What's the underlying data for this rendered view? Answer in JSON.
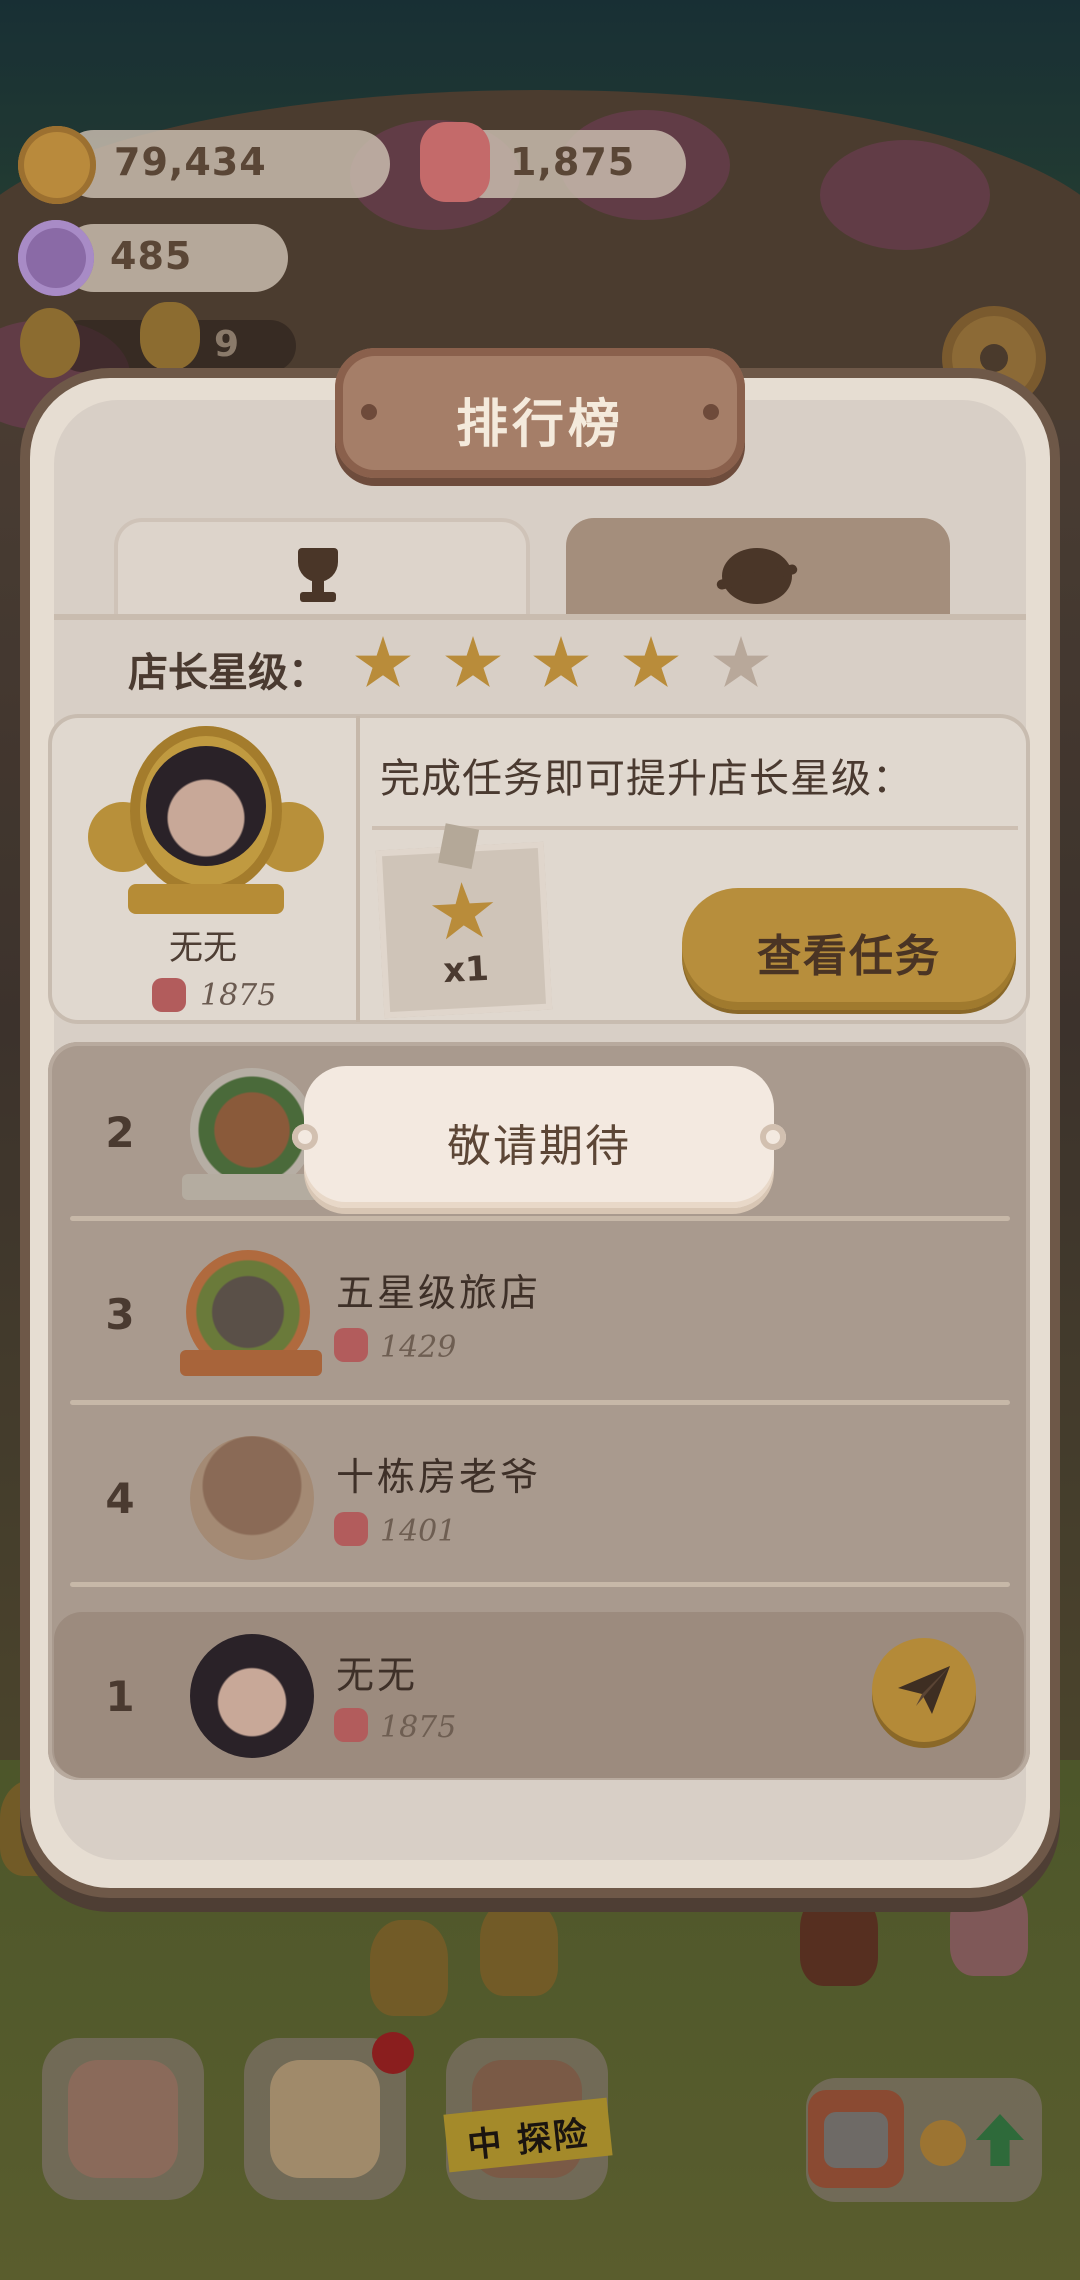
{
  "currencies": {
    "cookies": {
      "value": "79,434",
      "icon": "cookie-icon"
    },
    "gems": {
      "value": "1,875",
      "icon": "gem-icon"
    },
    "candy": {
      "value": "485",
      "icon": "candy-icon"
    }
  },
  "level_counter": {
    "value": "9"
  },
  "panel": {
    "title": "排行榜",
    "tabs": [
      {
        "icon": "trophy-icon",
        "active": true
      },
      {
        "icon": "planet-icon",
        "active": false
      }
    ],
    "star_label": "店长星级：",
    "stars_filled": 4,
    "stars_total": 5,
    "profile": {
      "name": "无无",
      "score": "1875"
    },
    "task_prompt": "完成任务即可提升店长星级：",
    "task_reward": "x1",
    "view_task_button": "查看任务"
  },
  "coming_soon": "敬请期待",
  "ranking": [
    {
      "rank": "2",
      "name": "",
      "score": ""
    },
    {
      "rank": "3",
      "name": "五星级旅店",
      "score": "1429"
    },
    {
      "rank": "4",
      "name": "十栋房老爷",
      "score": "1401"
    }
  ],
  "my_rank": {
    "rank": "1",
    "name": "无无",
    "score": "1875"
  },
  "bottom_bar": {
    "adventure_label": "中 探险"
  },
  "colors": {
    "accent_gold": "#b78e3c",
    "panel_bg": "#e6ddd2",
    "title_plate": "#a57e68"
  }
}
